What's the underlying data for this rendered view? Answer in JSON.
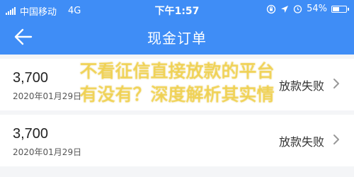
{
  "status_bar": {
    "carrier": "中国移动",
    "network": "4G",
    "time": "下午1:57",
    "battery": "54%",
    "battery_level": 0.54
  },
  "header": {
    "title": "现金订单"
  },
  "orders": [
    {
      "amount": "3,700",
      "date": "2020年01月29日",
      "status": "放款失败"
    },
    {
      "amount": "3,700",
      "date": "2020年01月29日",
      "status": "放款失败"
    }
  ],
  "watermark": {
    "line1": "不看征信直接放款的平台",
    "line2": "有没有？深度解析其实情"
  },
  "colors": {
    "header_bg": "#3f8df6",
    "page_bg": "#f4f5f7",
    "watermark": "#f1c40f"
  },
  "icons": {
    "back": "arrow-left-icon",
    "chevron": "chevron-right-icon",
    "lock": "orientation-lock-icon",
    "location": "location-icon",
    "alarm": "alarm-icon",
    "battery": "battery-icon"
  }
}
